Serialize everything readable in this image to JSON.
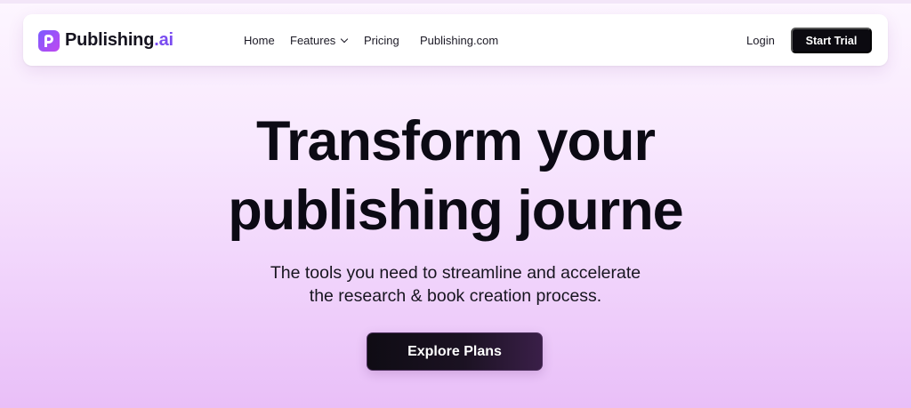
{
  "brand": {
    "name_main": "Publishing",
    "name_accent": ".ai",
    "logo_icon": "publishing-p-logo-icon",
    "accent_color": "#7a4cf0"
  },
  "nav": {
    "links": [
      "Home",
      "Features",
      "Pricing",
      "Publishing.com"
    ],
    "features_dropdown_icon": "chevron-down-icon",
    "login_label": "Login",
    "cta_label": "Start Trial"
  },
  "hero": {
    "title_line1": "Transform your",
    "title_line2": "publishing journe",
    "subtitle_line1": "The tools you need to streamline and accelerate",
    "subtitle_line2": "the research & book creation process.",
    "cta_label": "Explore Plans"
  }
}
